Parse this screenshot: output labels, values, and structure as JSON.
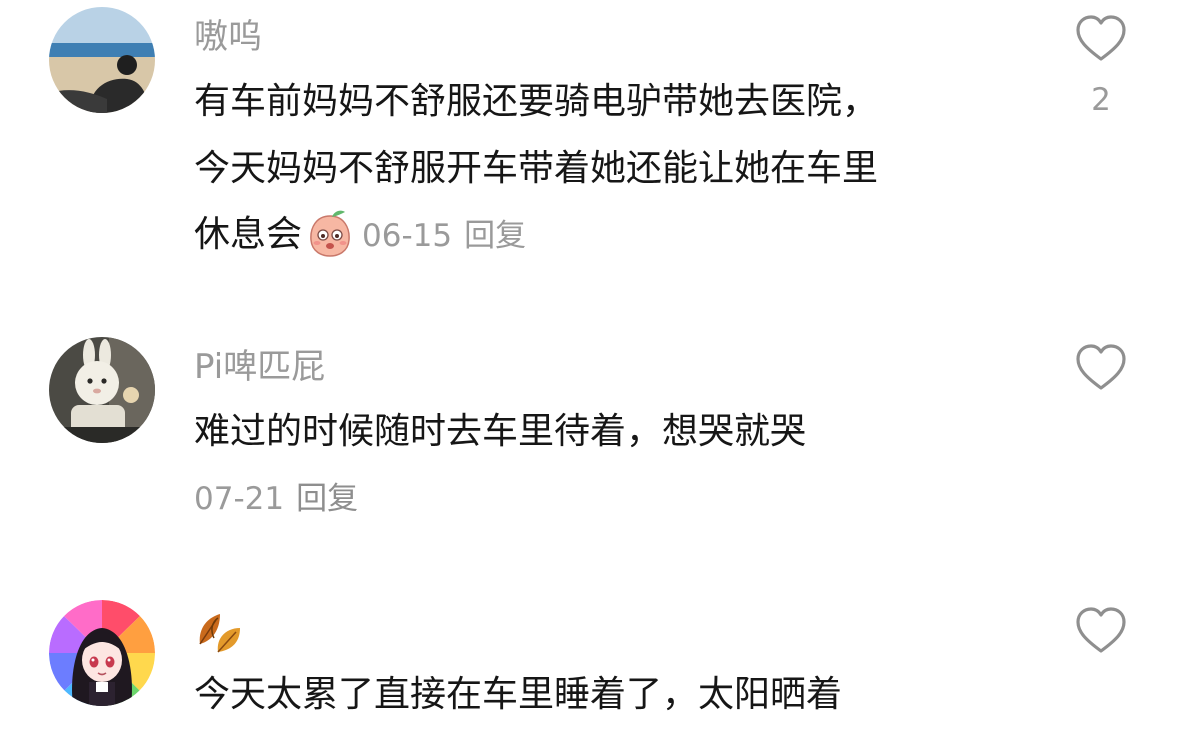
{
  "comments": [
    {
      "username": "嗷呜",
      "lines": [
        "有车前妈妈不舒服还要骑电驴带她去医院，",
        "今天妈妈不舒服开车带着她还能让她在车里",
        "休息会"
      ],
      "emoji": "blushing-peach-emoji",
      "date": "06-15",
      "reply_label": "回复",
      "likes": "2"
    },
    {
      "username": "Pi啤匹屁",
      "lines": [
        "难过的时候随时去车里待着，想哭就哭"
      ],
      "date": "07-21",
      "reply_label": "回复",
      "likes": ""
    },
    {
      "username": "🍂",
      "lines": [
        "今天太累了直接在车里睡着了，太阳晒着"
      ],
      "likes": ""
    }
  ],
  "icons": {
    "like": "heart-outline-icon",
    "username_3": "fallen-leaf-icon"
  },
  "colors": {
    "text": "#161616",
    "muted": "#9a9a9a",
    "background": "#ffffff"
  }
}
